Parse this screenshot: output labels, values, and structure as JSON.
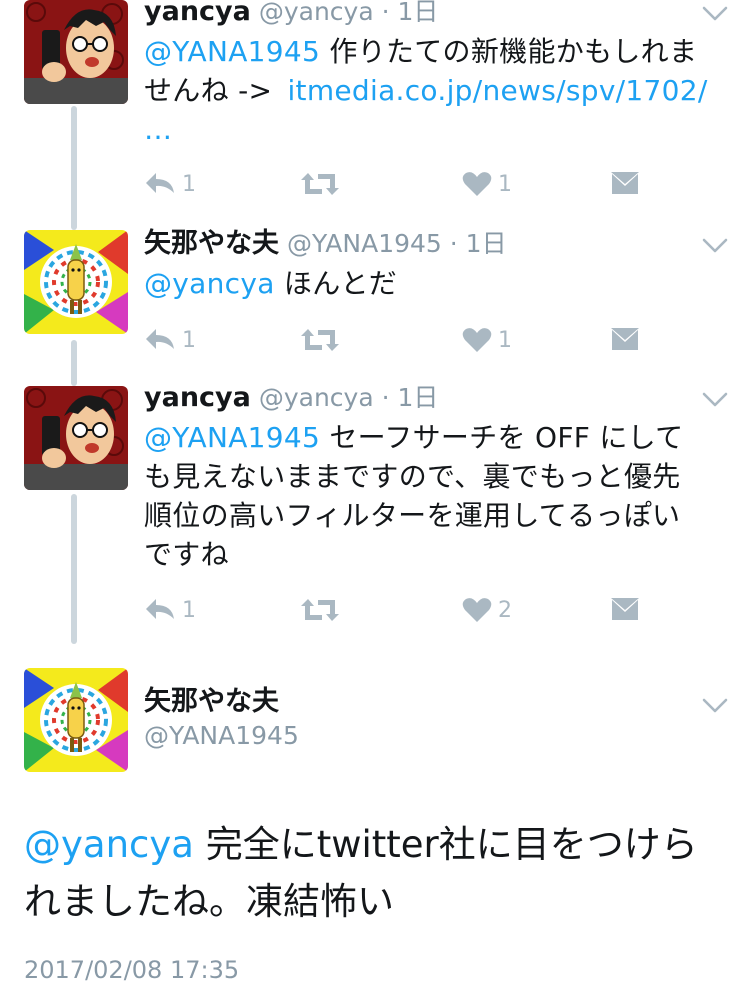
{
  "tweets": [
    {
      "name": "yancya",
      "handle": "@yancya",
      "dot": "·",
      "time": "1日",
      "mention": "@YANA1945",
      "text_1": " 作りたての新機能かもしれま",
      "text_2": "せんね -> ",
      "link": "itmedia.co.jp/news/spv/1702/",
      "link_more": "…",
      "reply_count": "1",
      "like_count": "1"
    },
    {
      "name": "矢那やな夫",
      "handle": "@YANA1945",
      "dot": "·",
      "time": "1日",
      "mention": "@yancya",
      "text_1": " ほんとだ",
      "reply_count": "1",
      "like_count": "1"
    },
    {
      "name": "yancya",
      "handle": "@yancya",
      "dot": "·",
      "time": "1日",
      "mention": "@YANA1945",
      "text_1": " セーフサーチを OFF にして",
      "text_2": "も見えないままですので、裏でもっと優先",
      "text_3": "順位の高いフィルターを運用してるっぽい",
      "text_4": "ですね",
      "reply_count": "1",
      "like_count": "2"
    }
  ],
  "focus": {
    "name": "矢那やな夫",
    "handle": "@YANA1945",
    "mention": "@yancya",
    "text_1": " 完全にtwitter社に目をつけら",
    "text_2": "れましたね。凍結怖い",
    "timestamp": "2017/02/08 17:35"
  },
  "colors": {
    "link": "#1da1f2",
    "muted": "#8899a6",
    "icon": "#aab8c2",
    "thread": "#ccd6dd"
  },
  "icons": [
    "reply-icon",
    "retweet-icon",
    "like-icon",
    "direct-message-icon",
    "chevron-down-icon"
  ]
}
